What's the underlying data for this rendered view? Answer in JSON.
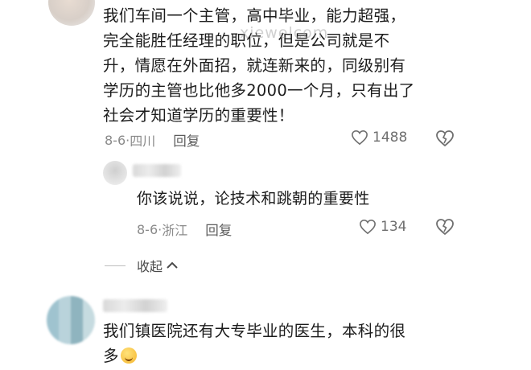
{
  "comments": [
    {
      "text_lines": [
        "我们车间一个主管，高中毕业，能力超强，",
        "完全能胜任经理的职位，但是公司就是不",
        "升，情愿在外面招，就连新来的，同级别有",
        "学历的主管也比他多2000一个月，只有出了",
        "社会才知道学历的重要性！"
      ],
      "date": "8-6",
      "location": "四川",
      "reply_label": "回复",
      "likes": "1488"
    },
    {
      "text": "你该说说，论技术和跳朝的重要性",
      "date": "8-6",
      "location": "浙江",
      "reply_label": "回复",
      "likes": "134"
    },
    {
      "text_line1": "我们镇医院还有大专毕业的医生，本科的很",
      "text_line2": "多"
    }
  ],
  "collapse_label": "收起",
  "watermark": "xiewelcom",
  "separator": "·",
  "colors": {
    "meta_gray": "#8a8a8a",
    "text": "#1c1c1c"
  },
  "icons": [
    "heart-icon",
    "dislike-heart-icon",
    "chevron-up-icon",
    "laughing-emoji-icon"
  ]
}
